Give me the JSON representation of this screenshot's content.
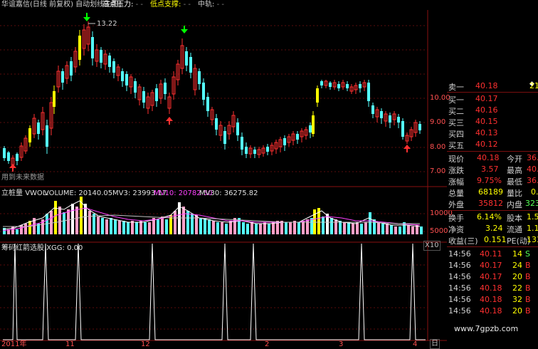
{
  "window": {
    "title": "华谊嘉信(日线 前复权) 自动划线主图(",
    "high_label": "高点压力:",
    "high_dash": "- -",
    "low_label": "低点支撑:",
    "low_dash": "- -",
    "mid_label": "中轨:",
    "mid_dash": "- -"
  },
  "price_panel": {
    "peak_label": "13.22",
    "future_note": "用到未来数据",
    "y_ticks": [
      "10.00",
      "9.00",
      "8.00",
      "7.00"
    ]
  },
  "volume_panel": {
    "name": "立桩量",
    "vol_label": "VWOL:",
    "volume_text": "VOLUME: 20140.05",
    "mv3": "MV3: 23993.17",
    "mv10": "MV10: 20782.50",
    "mv30": "MV30: 36275.82",
    "y_ticks": [
      "10000",
      "5000"
    ],
    "unit": "X10"
  },
  "indicator_panel": {
    "name": "筹码红箭选股",
    "value": "XGG: 0.00"
  },
  "x_axis": {
    "labels": [
      "2011年",
      "11",
      "12",
      "2",
      "3",
      "4",
      "日"
    ]
  },
  "quote_panel": {
    "sell1": {
      "label": "卖一",
      "price": "40.18",
      "vol": "21"
    },
    "buy": [
      {
        "label": "买一",
        "price": "40.17"
      },
      {
        "label": "买二",
        "price": "40.16"
      },
      {
        "label": "买三",
        "price": "40.15"
      },
      {
        "label": "买四",
        "price": "40.13"
      },
      {
        "label": "买五",
        "price": "40.12"
      }
    ],
    "stats": [
      {
        "k1": "现价",
        "v1": "40.18",
        "k2": "今开",
        "v2": "36.9"
      },
      {
        "k1": "涨跌",
        "v1": "3.57",
        "k2": "最高",
        "v2": "40.2"
      },
      {
        "k1": "涨幅",
        "v1": "9.75%",
        "k2": "最低",
        "v2": "36.0"
      },
      {
        "k1": "总量",
        "v1": "68189",
        "k2": "量比",
        "v2": "0.5"
      },
      {
        "k1": "外盘",
        "v1": "35812",
        "k2": "内盘",
        "v2": "3237"
      },
      {
        "k1": "换手",
        "v1": "6.14%",
        "k2": "股本",
        "v2": "1.55"
      },
      {
        "k1": "净资",
        "v1": "3.24",
        "k2": "流通",
        "v2": "1.11"
      },
      {
        "k1": "收益(三)",
        "v1": "0.151",
        "k2": "PE(动)",
        "v2": "133"
      }
    ],
    "ticks": [
      {
        "time": "14:56",
        "price": "40.11",
        "vol": "14",
        "side": "S"
      },
      {
        "time": "14:56",
        "price": "40.17",
        "vol": "24",
        "side": "B"
      },
      {
        "time": "14:56",
        "price": "40.17",
        "vol": "20",
        "side": "B"
      },
      {
        "time": "14:56",
        "price": "40.18",
        "vol": "22",
        "side": "B"
      },
      {
        "time": "14:56",
        "price": "40.18",
        "vol": "32",
        "side": "B"
      },
      {
        "time": "14:56",
        "price": "40.18",
        "vol": "20",
        "side": "B"
      }
    ]
  },
  "watermark": "www.7gpzb.com",
  "colors": {
    "up": "#ff3030",
    "down": "#54ffff",
    "yellow": "#ffff00",
    "grid": "#7a0f0f"
  }
}
